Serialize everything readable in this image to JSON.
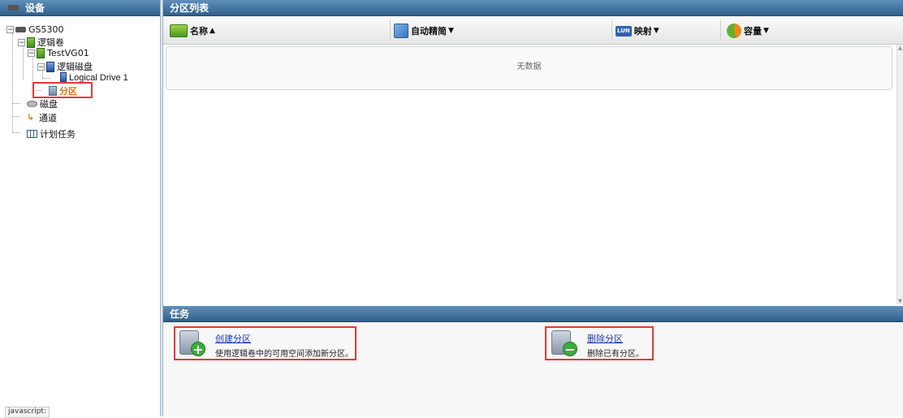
{
  "left_panel": {
    "title": "设备"
  },
  "tree": {
    "root": "GS5300",
    "logical_volume": "逻辑卷",
    "vg": "TestVG01",
    "logical_disk": "逻辑磁盘",
    "logical_drive": "Logical Drive 1",
    "partition": "分区",
    "disk": "磁盘",
    "channel": "通道",
    "scheduled_tasks": "计划任务"
  },
  "status_bar": "javascript:",
  "partition_list": {
    "title": "分区列表",
    "columns": [
      {
        "label": "名称",
        "sort": "▲"
      },
      {
        "label": "自动精简",
        "sort": "▼"
      },
      {
        "label": "映射",
        "sort": "▼",
        "badge": "LUN"
      },
      {
        "label": "容量",
        "sort": "▼"
      }
    ],
    "empty_text": "无数据"
  },
  "tasks": {
    "title": "任务",
    "items": [
      {
        "title": "创建分区",
        "desc": "使用逻辑卷中的可用空间添加新分区。",
        "badge": "+"
      },
      {
        "title": "删除分区",
        "desc": "删除已有分区。",
        "badge": "−"
      }
    ]
  },
  "colors": {
    "header": "#3a6a96",
    "selected": "#e86f13",
    "highlight_box": "#e53935",
    "link": "#1a3bb5"
  }
}
